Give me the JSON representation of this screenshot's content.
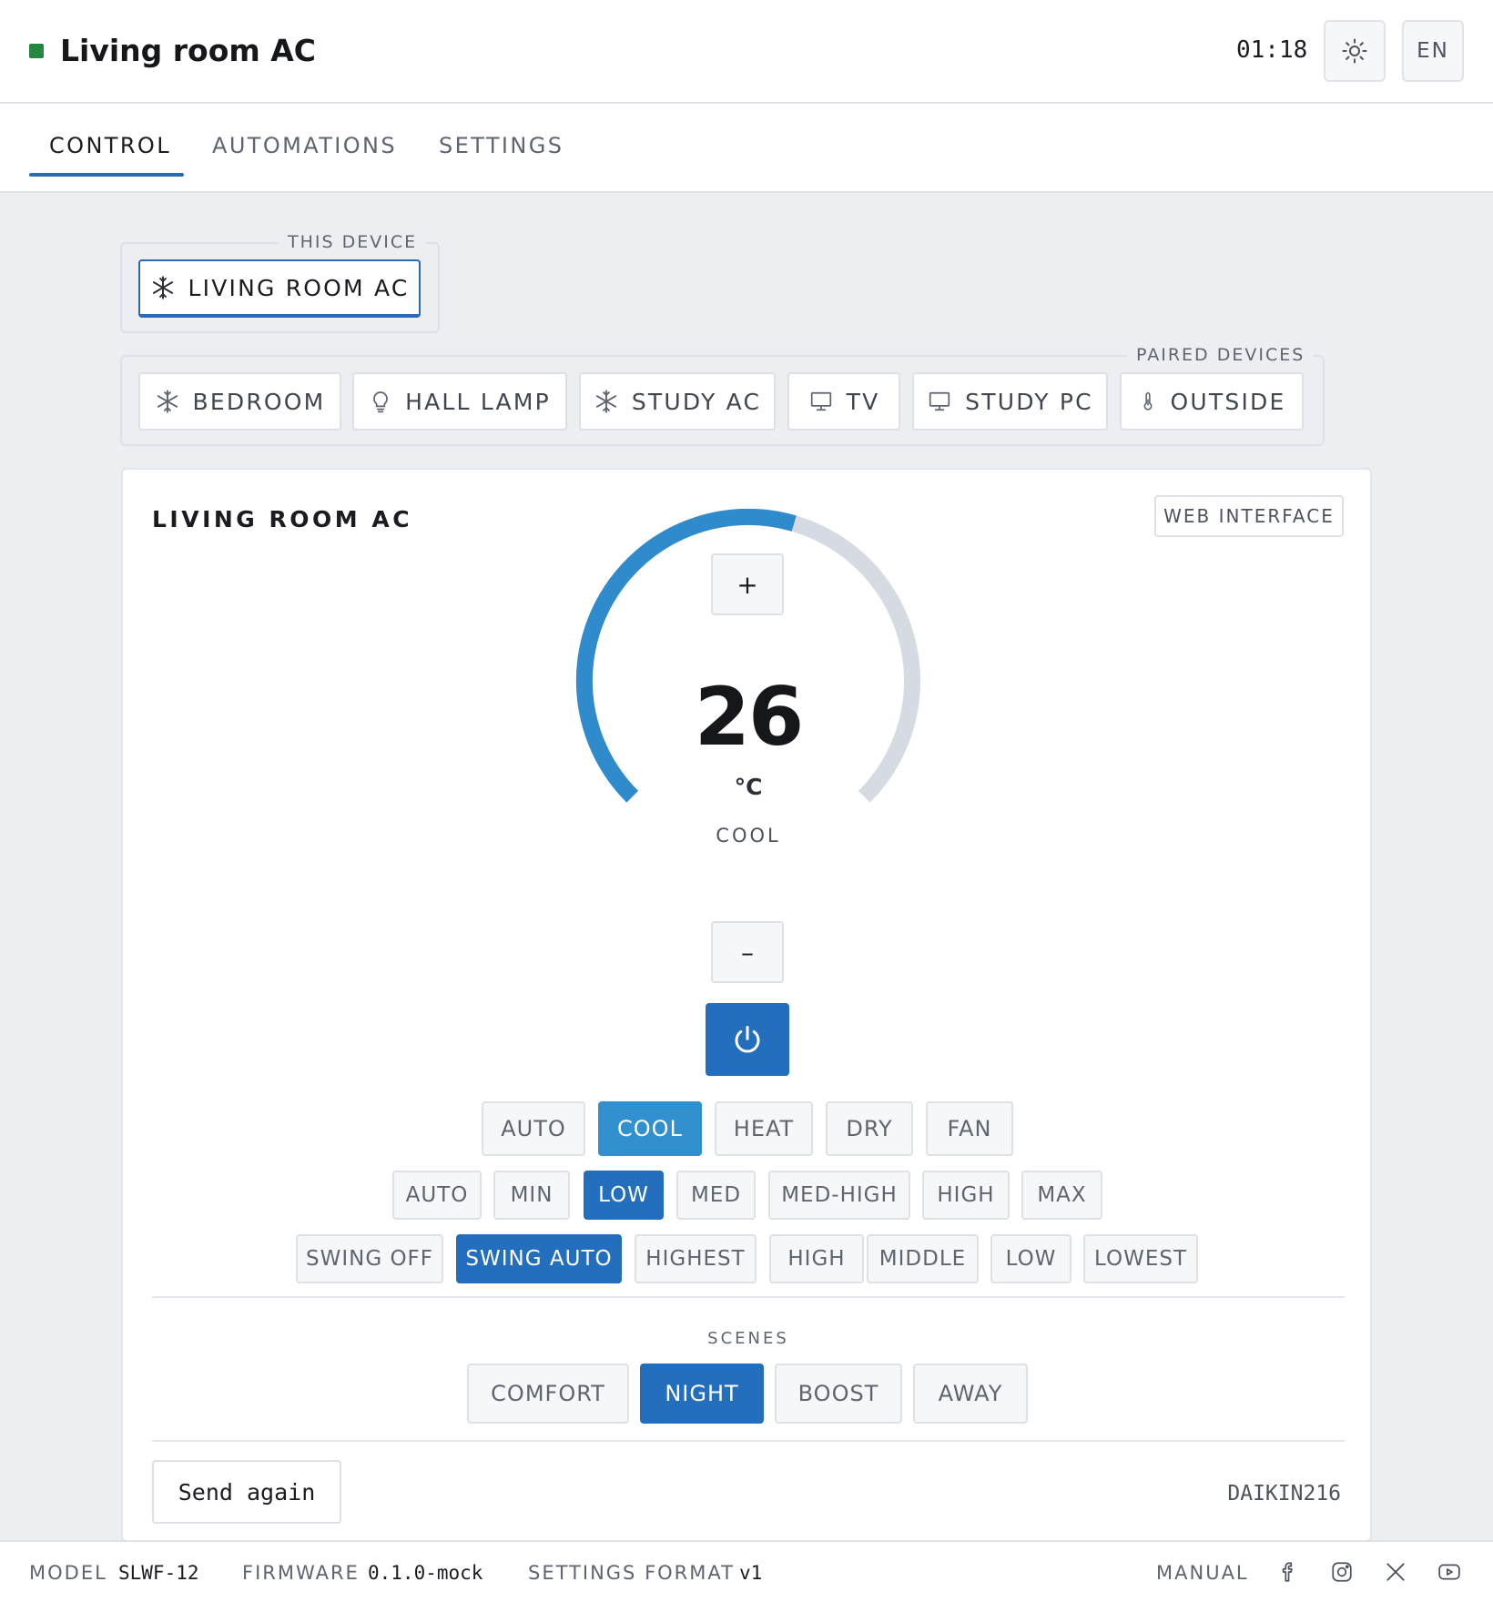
{
  "header": {
    "title": "Living room AC",
    "time": "01:18",
    "theme_icon": "sun-icon",
    "language": "EN",
    "status_color": "#23873e"
  },
  "tabs": [
    {
      "label": "CONTROL",
      "active": true
    },
    {
      "label": "AUTOMATIONS",
      "active": false
    },
    {
      "label": "SETTINGS",
      "active": false
    }
  ],
  "this_device": {
    "legend": "THIS DEVICE",
    "device": {
      "label": "LIVING ROOM AC",
      "icon": "snowflake-icon"
    }
  },
  "paired_devices": {
    "legend": "PAIRED DEVICES",
    "items": [
      {
        "label": "BEDROOM",
        "icon": "snowflake-icon"
      },
      {
        "label": "HALL LAMP",
        "icon": "lightbulb-icon"
      },
      {
        "label": "STUDY AC",
        "icon": "snowflake-icon"
      },
      {
        "label": "TV",
        "icon": "monitor-icon"
      },
      {
        "label": "STUDY PC",
        "icon": "monitor-icon"
      },
      {
        "label": "OUTSIDE",
        "icon": "thermometer-icon"
      }
    ]
  },
  "card": {
    "title": "LIVING ROOM AC",
    "web_interface": "WEB INTERFACE",
    "temperature": {
      "value": "26",
      "unit": "°C",
      "mode": "COOL",
      "increase": "+",
      "decrease": "–",
      "level": 0.56
    },
    "power_icon": "power-icon",
    "modes": [
      {
        "label": "AUTO",
        "selected": false
      },
      {
        "label": "COOL",
        "selected": true
      },
      {
        "label": "HEAT",
        "selected": false
      },
      {
        "label": "DRY",
        "selected": false
      },
      {
        "label": "FAN",
        "selected": false
      }
    ],
    "fan_speeds": [
      {
        "label": "AUTO",
        "selected": false
      },
      {
        "label": "MIN",
        "selected": false
      },
      {
        "label": "LOW",
        "selected": true
      },
      {
        "label": "MED",
        "selected": false
      },
      {
        "label": "MED-HIGH",
        "selected": false
      },
      {
        "label": "HIGH",
        "selected": false
      },
      {
        "label": "MAX",
        "selected": false
      }
    ],
    "swing": [
      {
        "label": "SWING OFF",
        "selected": false
      },
      {
        "label": "SWING AUTO",
        "selected": true
      },
      {
        "label": "HIGHEST",
        "selected": false
      },
      {
        "label": "HIGH",
        "selected": false
      },
      {
        "label": "MIDDLE",
        "selected": false
      },
      {
        "label": "LOW",
        "selected": false
      },
      {
        "label": "LOWEST",
        "selected": false
      }
    ],
    "scenes_label": "SCENES",
    "scenes": [
      {
        "label": "COMFORT",
        "selected": false
      },
      {
        "label": "NIGHT",
        "selected": true
      },
      {
        "label": "BOOST",
        "selected": false
      },
      {
        "label": "AWAY",
        "selected": false
      }
    ],
    "send_again": "Send again",
    "protocol": "DAIKIN216"
  },
  "footer": {
    "model_label": "MODEL",
    "model_value": "SLWF-12",
    "firmware_label": "FIRMWARE",
    "firmware_value": "0.1.0-mock",
    "settings_format_label": "SETTINGS FORMAT",
    "settings_format_value": "v1",
    "manual": "MANUAL",
    "social_icons": [
      "facebook-icon",
      "instagram-icon",
      "x-icon",
      "youtube-icon"
    ]
  },
  "colors": {
    "accent": "#236fbd",
    "accent_light": "#3290ce",
    "dial_track": "#d6dae2"
  }
}
